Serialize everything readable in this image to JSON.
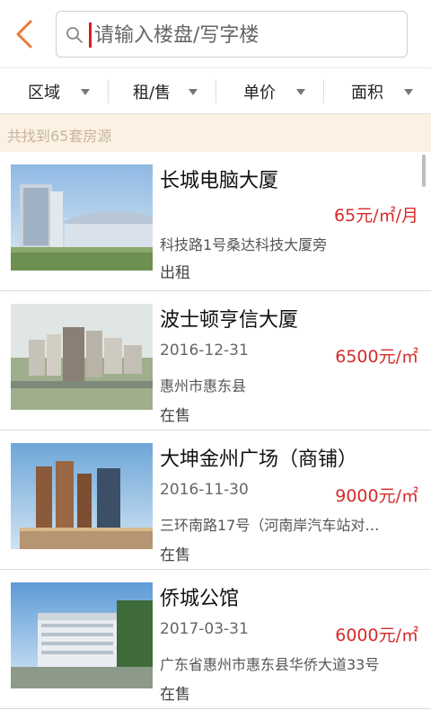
{
  "header": {
    "search_placeholder": "请输入楼盘/写字楼"
  },
  "filters": [
    {
      "label": "区域"
    },
    {
      "label": "租/售"
    },
    {
      "label": "单价"
    },
    {
      "label": "面积"
    }
  ],
  "result_count_text": "共找到65套房源",
  "listings": [
    {
      "title": "长城电脑大厦",
      "date": "",
      "price": "65元/㎡/月",
      "address": "科技路1号桑达科技大厦旁",
      "status": "出租"
    },
    {
      "title": "波士顿亨信大厦",
      "date": "2016-12-31",
      "price": "6500元/㎡",
      "address": "惠州市惠东县",
      "status": "在售"
    },
    {
      "title": "大坤金州广场（商铺）",
      "date": "2016-11-30",
      "price": "9000元/㎡",
      "address": "三环南路17号（河南岸汽车站对…",
      "status": "在售"
    },
    {
      "title": "侨城公馆",
      "date": "2017-03-31",
      "price": "6000元/㎡",
      "address": "广东省惠州市惠东县华侨大道33号",
      "status": "在售"
    }
  ],
  "colors": {
    "accent": "#e87a3a",
    "price": "#d72a2a",
    "banner_bg": "#fbf1e4"
  }
}
